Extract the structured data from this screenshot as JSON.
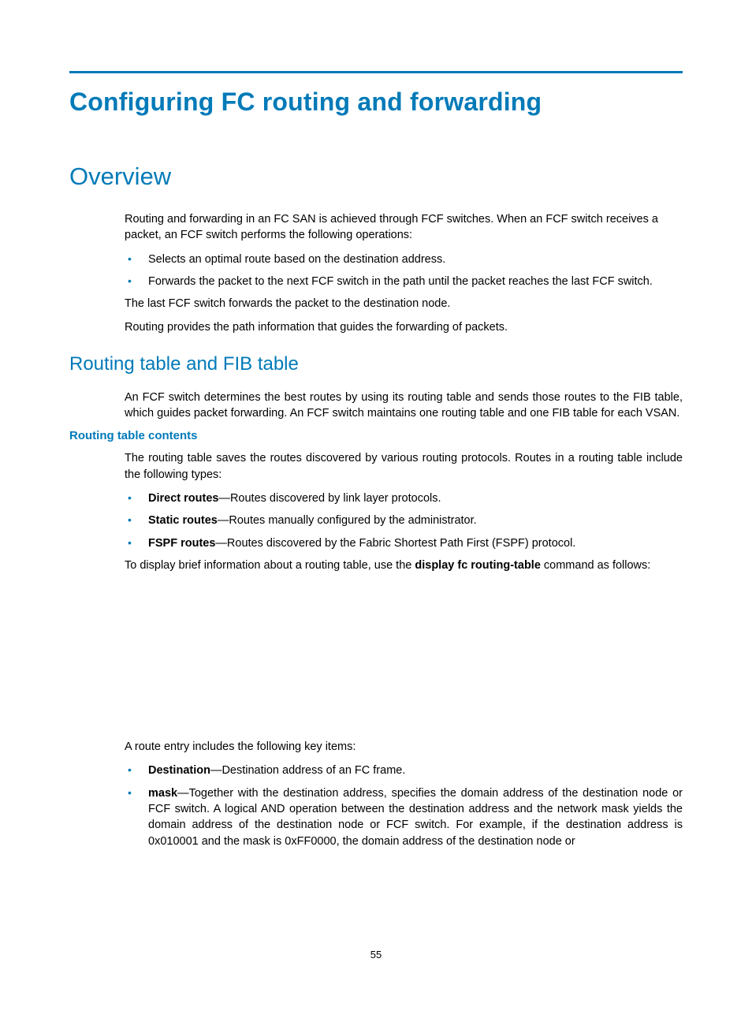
{
  "title": "Configuring FC routing and forwarding",
  "overview": {
    "heading": "Overview",
    "p1": "Routing and forwarding in an FC SAN is achieved through FCF switches. When an FCF switch receives a packet, an FCF switch performs the following operations:",
    "b1": "Selects an optimal route based on the destination address.",
    "b2": "Forwards the packet to the next FCF switch in the path until the packet reaches the last FCF switch.",
    "p2": "The last FCF switch forwards the packet to the destination node.",
    "p3": "Routing provides the path information that guides the forwarding of packets."
  },
  "routing": {
    "heading": "Routing table and FIB table",
    "p1": "An FCF switch determines the best routes by using its routing table and sends those routes to the FIB table, which guides packet forwarding. An FCF switch maintains one routing table and one FIB table for each VSAN.",
    "contents": {
      "heading": "Routing table contents",
      "p1": "The routing table saves the routes discovered by various routing protocols. Routes in a routing table include the following types:",
      "li1b": "Direct routes",
      "li1t": "—Routes discovered by link layer protocols.",
      "li2b": "Static routes",
      "li2t": "—Routes manually configured by the administrator.",
      "li3b": "FSPF routes",
      "li3t": "—Routes discovered by the Fabric Shortest Path First (FSPF) protocol.",
      "p2a": "To display brief information about a routing table, use the ",
      "p2cmd": "display fc routing-table",
      "p2b": " command as follows:",
      "p3": "A route entry includes the following key items:",
      "ki1b": "Destination",
      "ki1t": "—Destination address of an FC frame.",
      "ki2b": "mask",
      "ki2t": "—Together with the destination address, specifies the domain address of the destination node or FCF switch. A logical AND operation between the destination address and the network mask yields the domain address of the destination node or FCF switch. For example, if the destination address is 0x010001 and the mask is 0xFF0000, the domain address of the destination node or"
    }
  },
  "pagenum": "55"
}
